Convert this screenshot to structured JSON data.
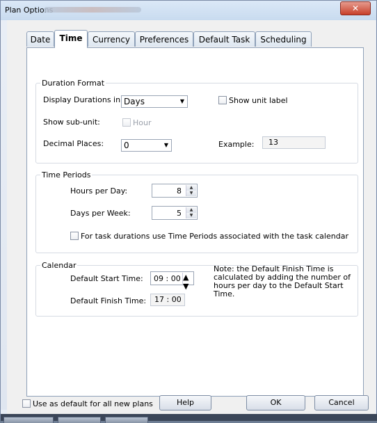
{
  "window": {
    "title": "Plan Options",
    "close_icon": "close-icon"
  },
  "tabs": [
    {
      "label": "Date",
      "active": false
    },
    {
      "label": "Time",
      "active": true
    },
    {
      "label": "Currency",
      "active": false
    },
    {
      "label": "Preferences",
      "active": false
    },
    {
      "label": "Default Task",
      "active": false
    },
    {
      "label": "Scheduling",
      "active": false
    }
  ],
  "duration_format": {
    "title": "Duration Format",
    "display_label": "Display Durations in:",
    "display_value": "Days",
    "show_unit_label": "Show unit label",
    "sub_unit_label": "Show sub-unit:",
    "sub_unit_option": "Hour",
    "decimal_label": "Decimal Places:",
    "decimal_value": "0",
    "example_label": "Example:",
    "example_value": "13"
  },
  "time_periods": {
    "title": "Time Periods",
    "hours_label": "Hours per Day:",
    "hours_value": "8",
    "days_label": "Days per Week:",
    "days_value": "5",
    "task_calendar_label": "For task durations use Time Periods associated with the task calendar"
  },
  "calendar": {
    "title": "Calendar",
    "start_label": "Default Start Time:",
    "start_value": "09 : 00",
    "finish_label": "Default Finish Time:",
    "finish_value": "17 : 00",
    "note_lines": [
      "Note: the Default Finish Time is",
      "calculated by adding the number of",
      "hours per day to the Default Start",
      "Time."
    ]
  },
  "footer": {
    "default_checkbox": "Use as default for all new plans",
    "help": "Help",
    "ok": "OK",
    "cancel": "Cancel"
  }
}
